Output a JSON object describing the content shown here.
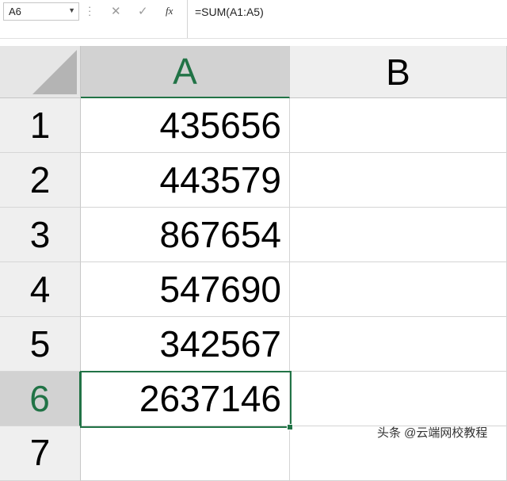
{
  "formula_bar": {
    "name_box": "A6",
    "name_dropdown": "▼",
    "cancel": "✕",
    "enter": "✓",
    "fx": "fx",
    "formula": "=SUM(A1:A5)"
  },
  "sheet": {
    "columns": [
      "A",
      "B"
    ],
    "rows": [
      {
        "num": "1",
        "a": "435656"
      },
      {
        "num": "2",
        "a": "443579"
      },
      {
        "num": "3",
        "a": "867654"
      },
      {
        "num": "4",
        "a": "547690"
      },
      {
        "num": "5",
        "a": "342567"
      },
      {
        "num": "6",
        "a": "2637146"
      },
      {
        "num": "7",
        "a": ""
      }
    ],
    "active_cell": "A6",
    "accent": "#217346"
  },
  "watermark": "头条 @云端网校教程"
}
